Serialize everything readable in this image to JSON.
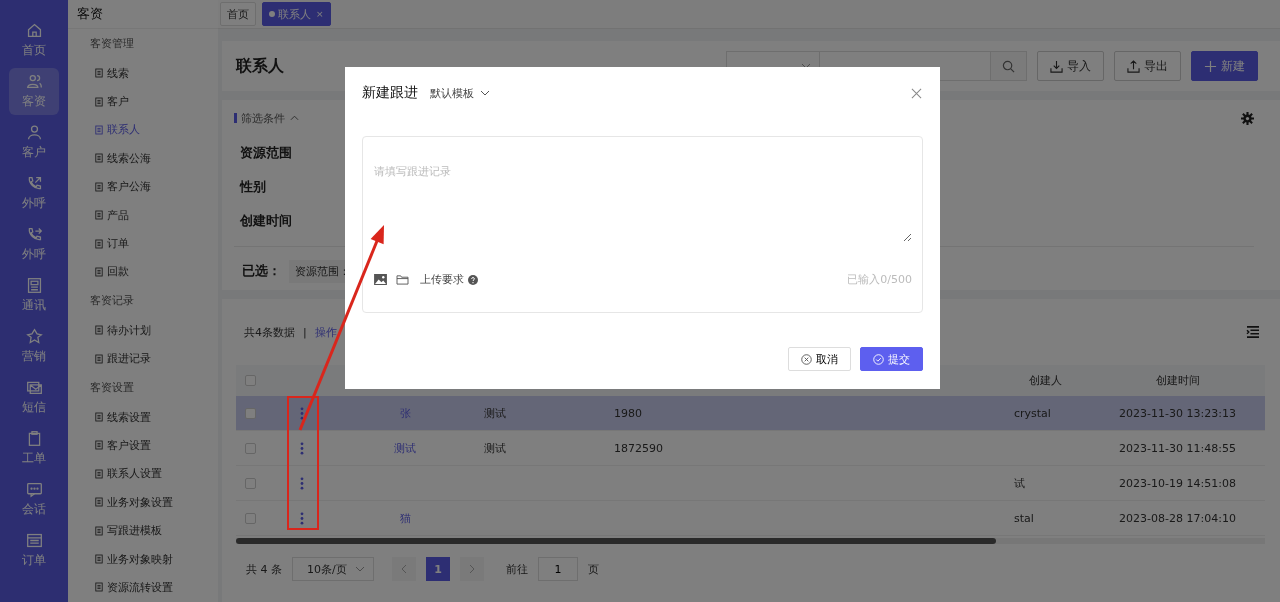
{
  "nav": {
    "items": [
      {
        "label": "首页",
        "kind": "home",
        "selected": false
      },
      {
        "label": "客资",
        "kind": "users",
        "selected": true
      },
      {
        "label": "客户",
        "kind": "user",
        "selected": false
      },
      {
        "label": "外呼",
        "kind": "phone",
        "selected": false
      },
      {
        "label": "外呼",
        "kind": "phone-forward",
        "selected": false
      },
      {
        "label": "通讯",
        "kind": "document",
        "selected": false
      },
      {
        "label": "营销",
        "kind": "star",
        "selected": false
      },
      {
        "label": "短信",
        "kind": "mail",
        "selected": false
      },
      {
        "label": "工单",
        "kind": "clipboard",
        "selected": false
      },
      {
        "label": "会话",
        "kind": "chat",
        "selected": false
      },
      {
        "label": "订单",
        "kind": "list",
        "selected": false
      }
    ]
  },
  "submenu": {
    "title": "客资",
    "groups": [
      {
        "title": "客资管理",
        "items": [
          {
            "label": "线索",
            "selected": false
          },
          {
            "label": "客户",
            "selected": false
          },
          {
            "label": "联系人",
            "selected": true
          },
          {
            "label": "线索公海",
            "selected": false
          },
          {
            "label": "客户公海",
            "selected": false
          },
          {
            "label": "产品",
            "selected": false
          },
          {
            "label": "订单",
            "selected": false
          },
          {
            "label": "回款",
            "selected": false
          }
        ]
      },
      {
        "title": "客资记录",
        "items": [
          {
            "label": "待办计划",
            "selected": false
          },
          {
            "label": "跟进记录",
            "selected": false
          }
        ]
      },
      {
        "title": "客资设置",
        "items": [
          {
            "label": "线索设置",
            "selected": false
          },
          {
            "label": "客户设置",
            "selected": false
          },
          {
            "label": "联系人设置",
            "selected": false
          },
          {
            "label": "业务对象设置",
            "selected": false
          },
          {
            "label": "写跟进模板",
            "selected": false
          },
          {
            "label": "业务对象映射",
            "selected": false
          },
          {
            "label": "资源流转设置",
            "selected": false
          }
        ]
      }
    ]
  },
  "tabs": [
    {
      "label": "首页",
      "selected": false
    },
    {
      "label": "联系人",
      "selected": true,
      "close": "×"
    }
  ],
  "header": {
    "title": "联系人",
    "buttons": [
      {
        "label": "导入",
        "kind": "import"
      },
      {
        "label": "导出",
        "kind": "export"
      },
      {
        "label": "新建",
        "kind": "create"
      }
    ]
  },
  "filters": {
    "title": "筛选条件",
    "expanded": true,
    "rows": [
      "资源范围",
      "性别",
      "创建时间"
    ],
    "selected_label": "已选：",
    "chips": [
      "资源范围："
    ]
  },
  "table": {
    "summary": "共4条数据",
    "separator": "|",
    "action_link": "操作",
    "select_all_checked": false,
    "columns": [
      {
        "label": "创建人"
      },
      {
        "label": "创建时间"
      }
    ],
    "rows": [
      {
        "checked": false,
        "highlighted": true,
        "name": "张",
        "col3": "测试",
        "phone": "1980",
        "creator": "crystal",
        "created": "2023-11-30 13:23:13"
      },
      {
        "checked": false,
        "highlighted": false,
        "name": "测试",
        "col3": "测试",
        "phone": "1872590",
        "created": "2023-11-30 11:48:55"
      },
      {
        "checked": false,
        "highlighted": false,
        "creator": "试",
        "created": "2023-10-19 14:51:08"
      },
      {
        "checked": false,
        "highlighted": false,
        "name": "猫",
        "creator": "stal",
        "created": "2023-08-28 17:04:10"
      }
    ]
  },
  "pagination": {
    "total": "共 4 条",
    "page_size": "10条/页",
    "pages": [
      {
        "label": "1",
        "selected": true
      }
    ],
    "goto_label": "前往",
    "goto_value": "1",
    "goto_suffix": "页"
  },
  "modal": {
    "title": "新建跟进",
    "template": "默认模板",
    "placeholder": "请填写跟进记录",
    "upload_label": "上传要求",
    "counter": "已输入0/500",
    "buttons": [
      {
        "label": "取消",
        "kind": "cancel"
      },
      {
        "label": "提交",
        "kind": "submit"
      }
    ]
  }
}
